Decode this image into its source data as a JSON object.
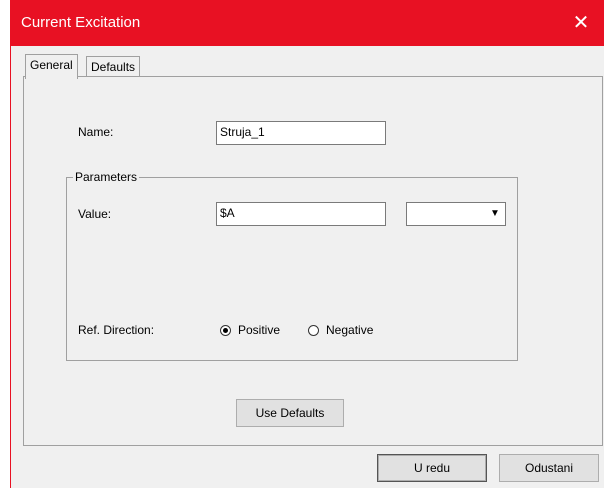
{
  "window": {
    "title": "Current Excitation",
    "close_glyph": "✕"
  },
  "tabs": [
    {
      "label": "General",
      "selected": true
    },
    {
      "label": "Defaults",
      "selected": false
    }
  ],
  "general": {
    "name_label": "Name:",
    "name_value": "Struja_1",
    "parameters_group": "Parameters",
    "value_label": "Value:",
    "value_value": "$A",
    "unit_selected": "",
    "ref_direction_label": "Ref. Direction:",
    "radio_positive": "Positive",
    "radio_negative": "Negative",
    "selected_direction": "Positive",
    "use_defaults_button": "Use Defaults"
  },
  "footer": {
    "ok_button": "U redu",
    "cancel_button": "Odustani"
  },
  "colors": {
    "titlebar": "#e81123",
    "dialog_bg": "#f0f0f0"
  },
  "icons": {
    "close": "close-icon",
    "dropdown": "chevron-down-icon"
  }
}
